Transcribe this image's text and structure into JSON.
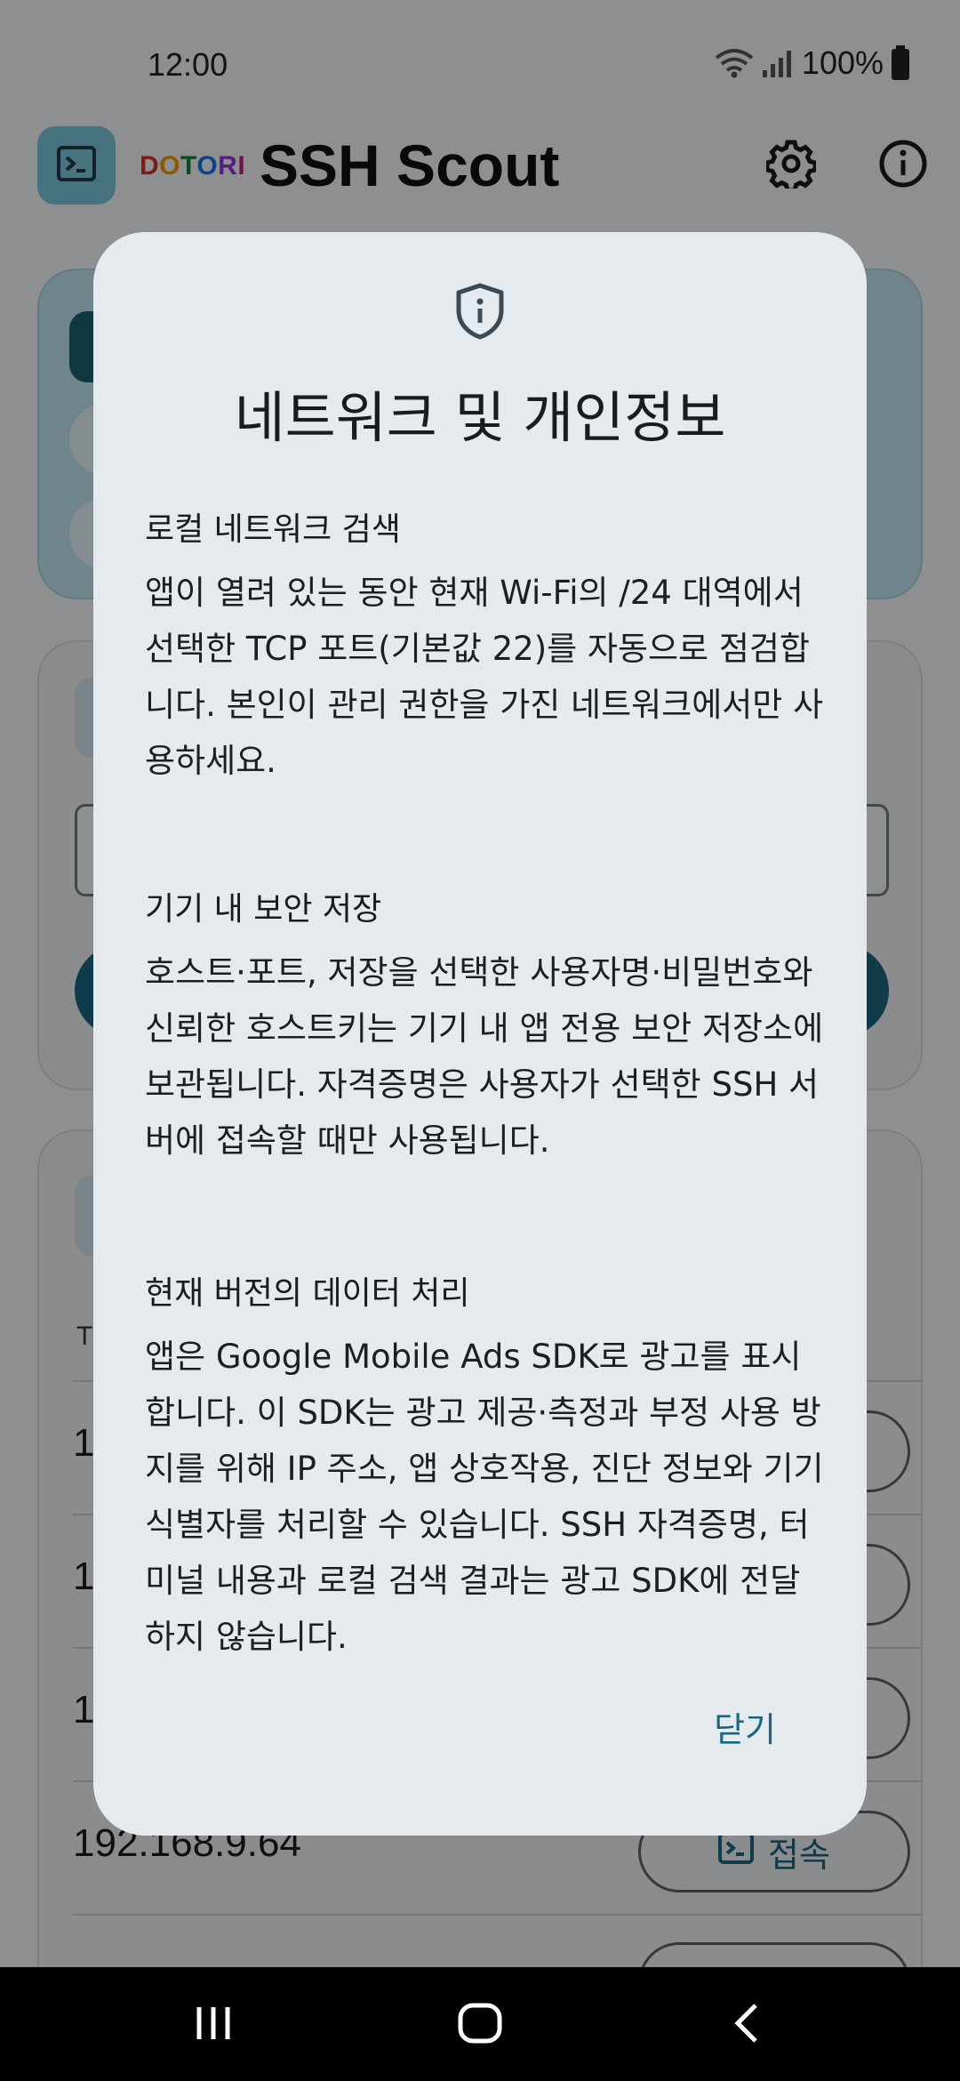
{
  "status_bar": {
    "time": "12:00",
    "battery": "100%",
    "icons": [
      "wifi-icon",
      "signal-icon",
      "battery-icon"
    ]
  },
  "app_bar": {
    "brand_letters": [
      "D",
      "O",
      "T",
      "O",
      "R",
      "I"
    ],
    "title": "SSH Scout",
    "icons": [
      "terminal-icon",
      "gear-icon",
      "info-icon"
    ]
  },
  "background": {
    "list_col_label": "T",
    "rows": [
      {
        "ip": "1",
        "button": ""
      },
      {
        "ip": "1",
        "button": ""
      },
      {
        "ip": "1",
        "button": ""
      },
      {
        "ip": "192.168.9.64",
        "button": "접속"
      }
    ]
  },
  "dialog": {
    "icon": "shield-info-icon",
    "title": "네트워크 및 개인정보",
    "sections": [
      {
        "heading": "로컬 네트워크 검색",
        "body": "앱이 열려 있는 동안 현재 Wi-Fi의 /24 대역에서 선택한 TCP 포트(기본값 22)를 자동으로 점검합니다. 본인이 관리 권한을 가진 네트워크에서만 사용하세요."
      },
      {
        "heading": "기기 내 보안 저장",
        "body": "호스트·포트, 저장을 선택한 사용자명·비밀번호와 신뢰한 호스트키는 기기 내 앱 전용 보안 저장소에 보관됩니다. 자격증명은 사용자가 선택한 SSH 서버에 접속할 때만 사용됩니다."
      },
      {
        "heading": "현재 버전의 데이터 처리",
        "body": "앱은 Google Mobile Ads SDK로 광고를 표시합니다. 이 SDK는 광고 제공·측정과 부정 사용 방지를 위해 IP 주소, 앱 상호작용, 진단 정보와 기기 식별자를 처리할 수 있습니다. SSH 자격증명, 터미널 내용과 로컬 검색 결과는 광고 SDK에 전달하지 않습니다."
      }
    ],
    "close_label": "닫기"
  },
  "nav_bar": {
    "icons": [
      "recents-icon",
      "home-icon",
      "back-icon"
    ]
  }
}
